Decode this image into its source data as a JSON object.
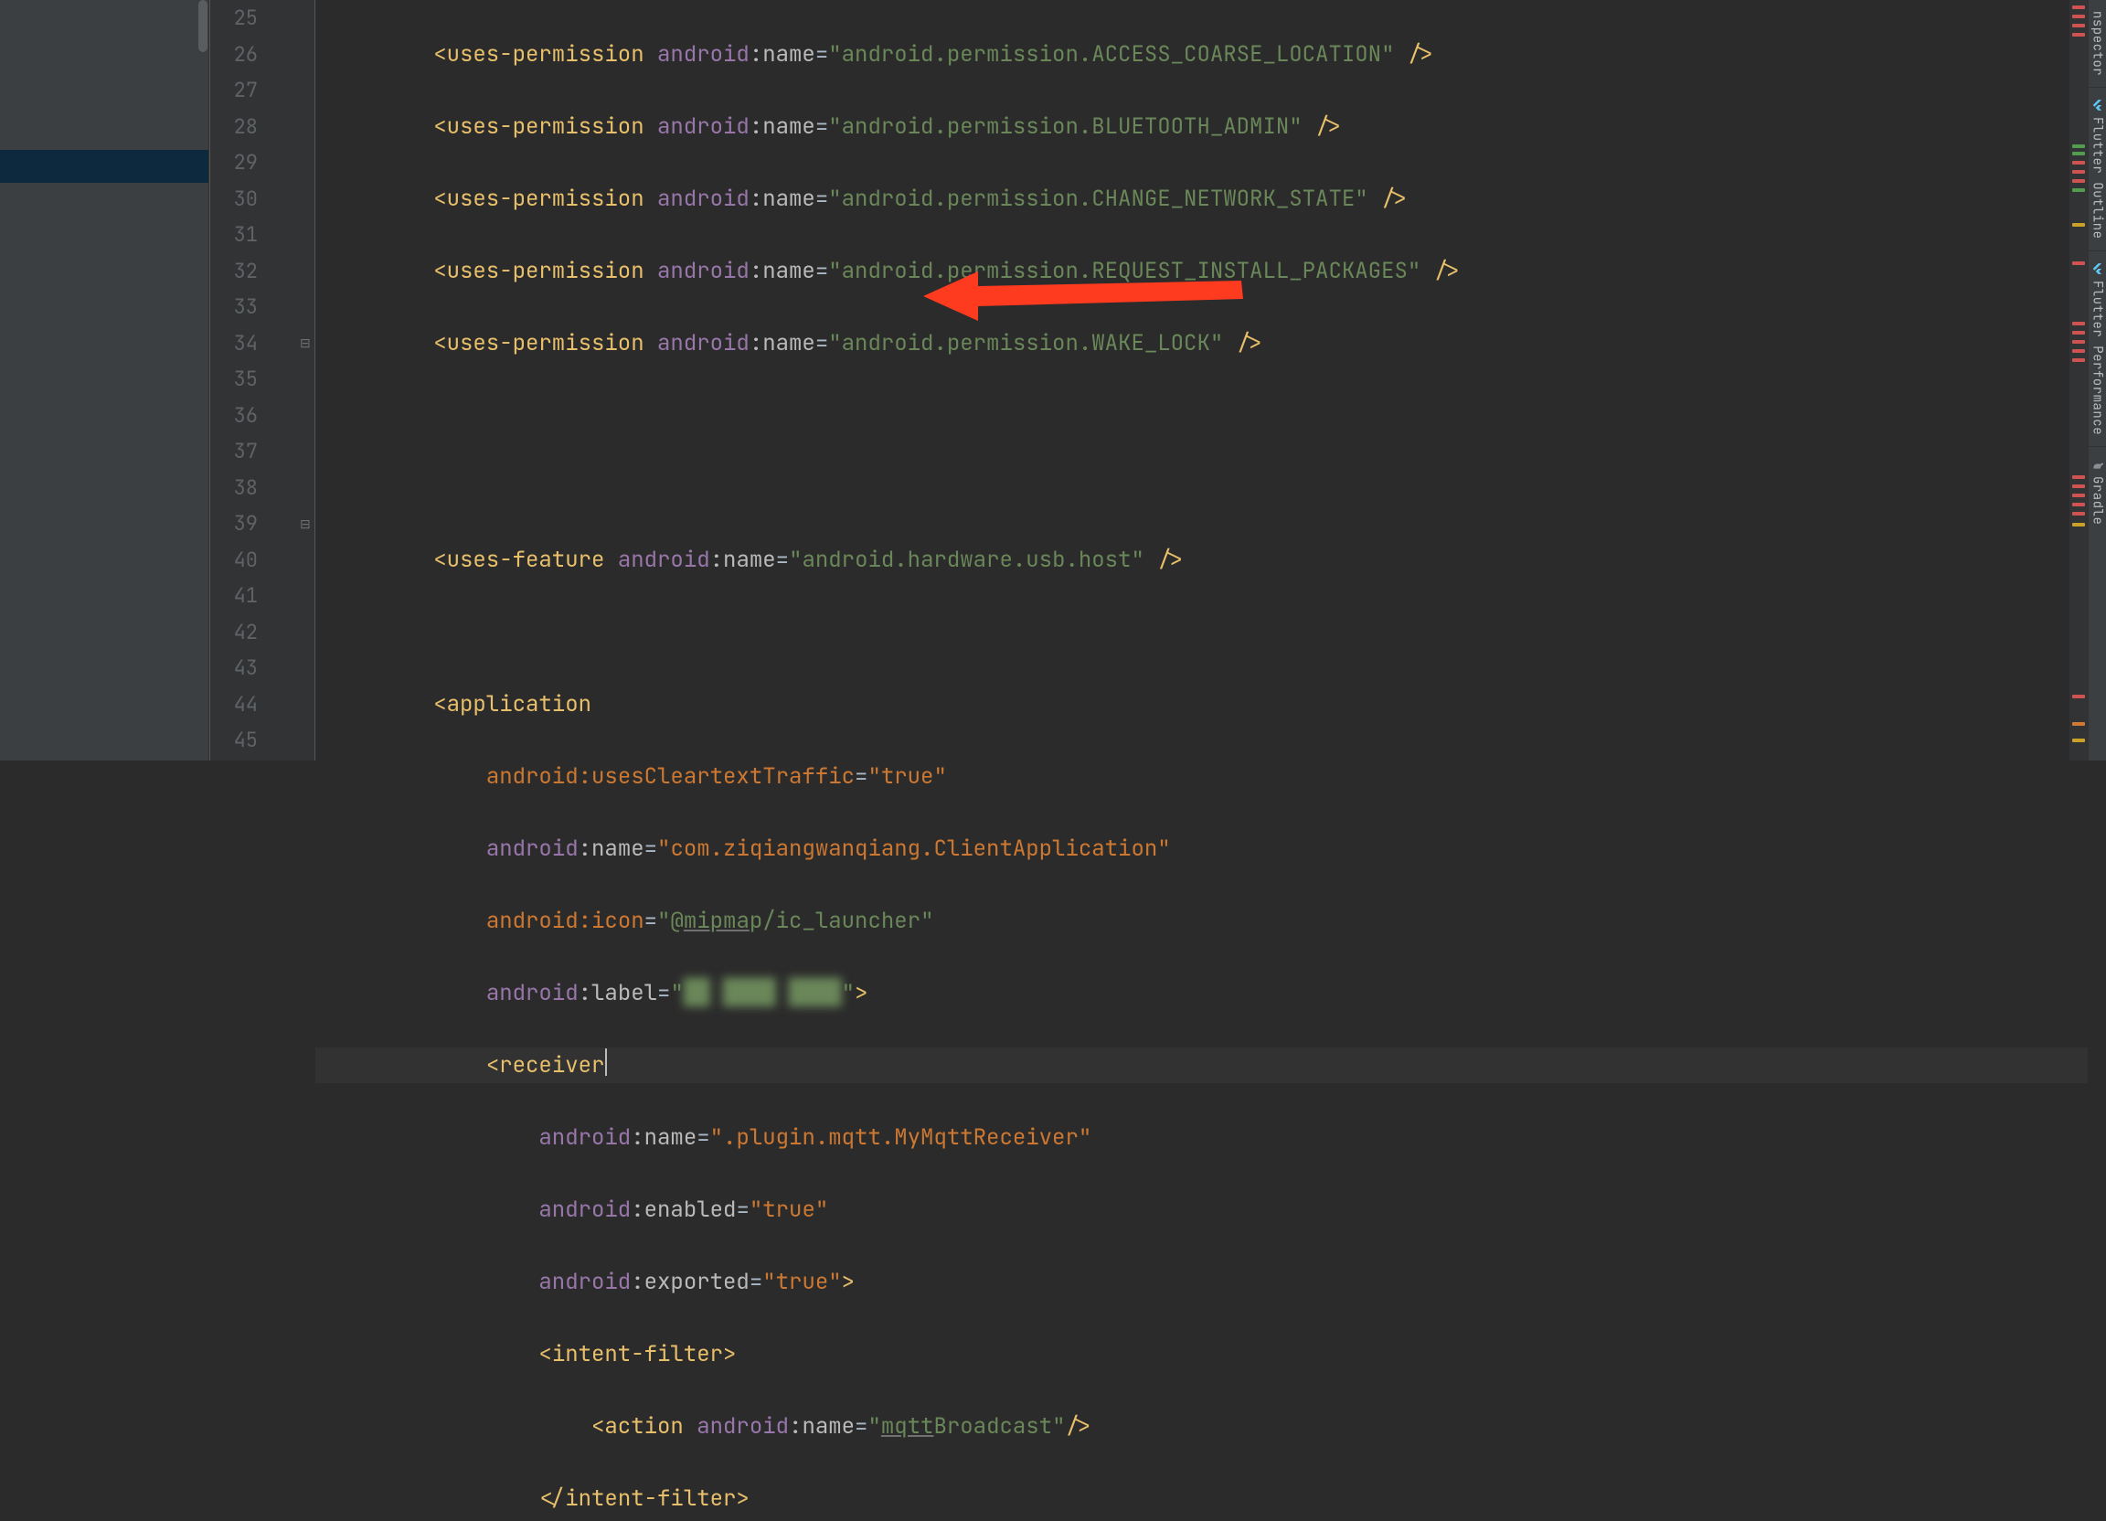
{
  "lines": {
    "l25": {
      "num": "25",
      "attr": "name",
      "val": "android.permission.ACCESS_COARSE_LOCATION"
    },
    "l26": {
      "num": "26",
      "attr": "name",
      "val": "android.permission.BLUETOOTH_ADMIN"
    },
    "l27": {
      "num": "27",
      "attr": "name",
      "val": "android.permission.CHANGE_NETWORK_STATE"
    },
    "l28": {
      "num": "28",
      "attr": "name",
      "val": "android.permission.REQUEST_INSTALL_PACKAGES"
    },
    "l29": {
      "num": "29",
      "attr": "name",
      "val": "android.permission.WAKE_LOCK"
    },
    "l30": {
      "num": "30"
    },
    "l31": {
      "num": "31"
    },
    "l32": {
      "num": "32",
      "tag": "uses-feature",
      "attr": "name",
      "val": "android.hardware.usb.host"
    },
    "l33": {
      "num": "33"
    },
    "l34": {
      "num": "34",
      "tag": "application"
    },
    "l35": {
      "num": "35",
      "attr": "usesCleartextTraffic",
      "val": "true"
    },
    "l36": {
      "num": "36",
      "attr": "name",
      "val": "com.ziqiangwanqiang.ClientApplication"
    },
    "l37": {
      "num": "37",
      "attr": "icon",
      "val_prefix": "@",
      "val_under": "mipma",
      "val_rest": "p/ic_launcher"
    },
    "l38": {
      "num": "38",
      "attr": "label"
    },
    "l39": {
      "num": "39",
      "tag": "receiver"
    },
    "l40": {
      "num": "40",
      "attr": "name",
      "val": ".plugin.mqtt.MyMqttReceiver"
    },
    "l41": {
      "num": "41",
      "attr": "enabled",
      "val": "true"
    },
    "l42": {
      "num": "42",
      "attr": "exported",
      "val": "true"
    },
    "l43": {
      "num": "43",
      "tag": "intent-filter"
    },
    "l44": {
      "num": "44",
      "tag": "action",
      "attr": "name",
      "val_under": "mqtt",
      "val_rest": "Broadcast"
    },
    "l45": {
      "num": "45",
      "tag": "intent-filter"
    }
  },
  "shared": {
    "ns": "android",
    "uses_perm": "uses-permission",
    "open": "<",
    "close": ">",
    "selfclose": " />",
    "eq": "=",
    "q": "\"",
    "lt_slash": "</"
  },
  "tool_tabs": {
    "inspector": "nspector",
    "outline": "Flutter Outline",
    "performance": "Flutter Performance",
    "gradle": "Gradle"
  },
  "annotation": {
    "color": "#ff3b1f"
  }
}
